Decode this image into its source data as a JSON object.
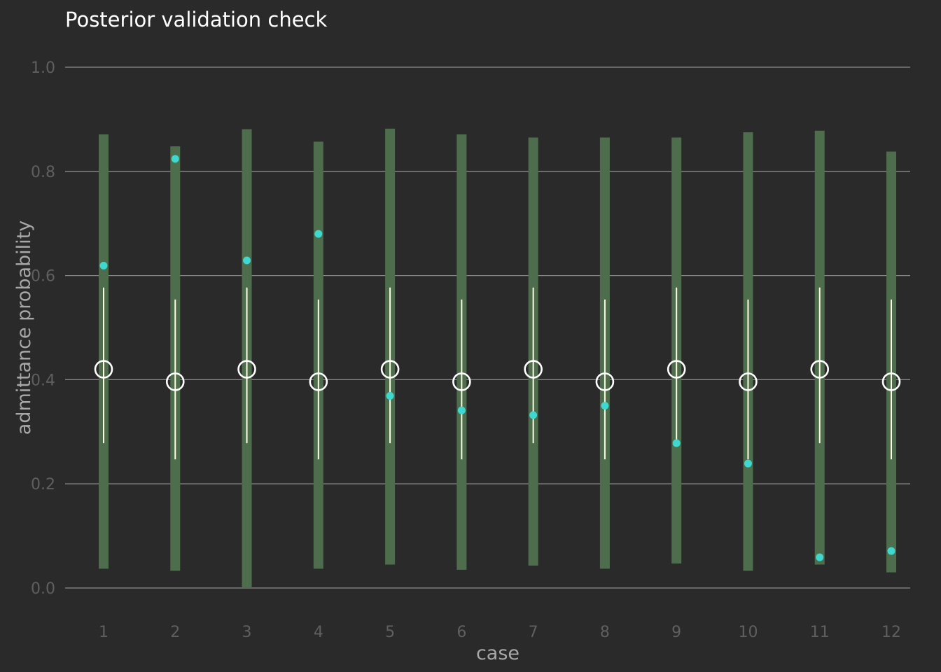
{
  "chart_data": {
    "type": "scatter",
    "title": "Posterior validation check",
    "xlabel": "case",
    "ylabel": "admittance probability",
    "ylim": [
      0,
      1
    ],
    "yticks": [
      "0.0",
      "0.2",
      "0.4",
      "0.6",
      "0.8",
      "1.0"
    ],
    "grid": "horizontal",
    "categories": [
      "1",
      "2",
      "3",
      "4",
      "5",
      "6",
      "7",
      "8",
      "9",
      "10",
      "11",
      "12"
    ],
    "series": [
      {
        "role": "prediction_interval",
        "low": [
          0.037,
          0.033,
          0.0,
          0.037,
          0.045,
          0.035,
          0.043,
          0.037,
          0.047,
          0.033,
          0.045,
          0.03
        ],
        "high": [
          0.871,
          0.848,
          0.881,
          0.857,
          0.882,
          0.871,
          0.865,
          0.865,
          0.865,
          0.875,
          0.878,
          0.838
        ]
      },
      {
        "role": "credible_interval",
        "low": [
          0.278,
          0.247,
          0.278,
          0.247,
          0.278,
          0.247,
          0.278,
          0.247,
          0.278,
          0.247,
          0.278,
          0.247
        ],
        "high": [
          0.577,
          0.554,
          0.577,
          0.554,
          0.577,
          0.554,
          0.577,
          0.554,
          0.577,
          0.554,
          0.577,
          0.554
        ]
      },
      {
        "role": "posterior_mean",
        "values": [
          0.42,
          0.396,
          0.42,
          0.396,
          0.42,
          0.396,
          0.42,
          0.396,
          0.42,
          0.396,
          0.42,
          0.396
        ]
      },
      {
        "role": "observed",
        "values": [
          0.619,
          0.824,
          0.629,
          0.68,
          0.369,
          0.341,
          0.332,
          0.35,
          0.278,
          0.239,
          0.059,
          0.071
        ]
      }
    ],
    "colors": {
      "background": "#2a2a2a",
      "interval_bar": "#4d6d4c",
      "credible_line": "#fcfce0",
      "mean_marker": "#ffffff",
      "observed_point": "#3ed8d0",
      "grid": "#8a8a8a"
    }
  }
}
